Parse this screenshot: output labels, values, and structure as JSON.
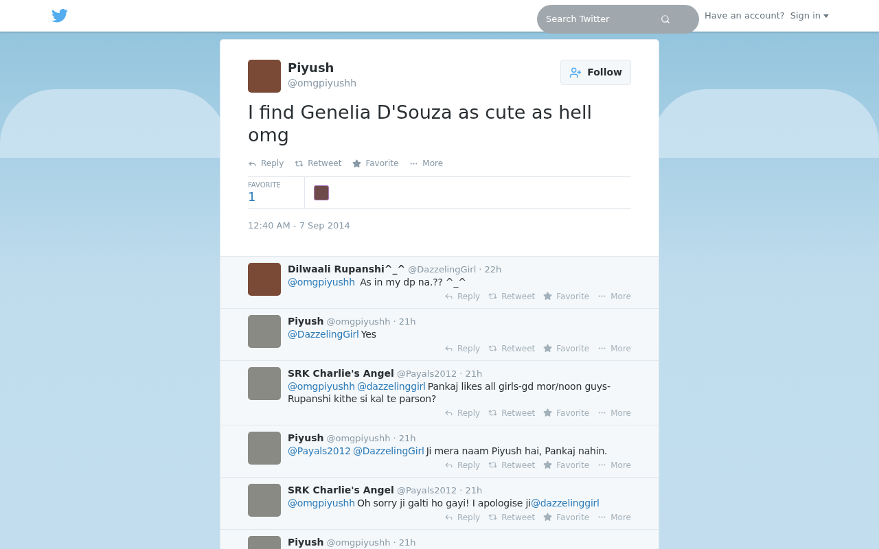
{
  "header": {
    "search": {
      "placeholder": "Search Twitter"
    },
    "account_prompt": "Have an account?",
    "sign_in": "Sign in"
  },
  "tweet": {
    "name": "Piyush",
    "handle": "@omgpiyushh",
    "follow": "Follow",
    "text": "I find Genelia D'Souza as cute as hell omg",
    "actions": [
      {
        "kind": "reply",
        "label": "Reply"
      },
      {
        "kind": "retweet",
        "label": "Retweet"
      },
      {
        "kind": "favorite",
        "label": "Favorite"
      },
      {
        "kind": "more",
        "label": "More"
      }
    ],
    "stats": {
      "label": "FAVORITE",
      "count": "1"
    },
    "timestamp": "12:40 AM - 7 Sep 2014"
  },
  "replies": [
    {
      "name": "Dilwaali Rupanshi^_^",
      "handle": "@DazzelingGirl",
      "time": "· 22h",
      "parts": [
        {
          "kind": "mention",
          "text": "@omgpiyushh"
        },
        {
          "kind": "text",
          "text": " As in my dp na.?? ^_^"
        }
      ],
      "actions": [
        "Reply",
        "Retweet",
        "Favorite",
        "More"
      ]
    },
    {
      "name": "Piyush",
      "handle": "@omgpiyushh",
      "time": "· 21h",
      "parts": [
        {
          "kind": "mention",
          "text": "@DazzelingGirl"
        },
        {
          "kind": "text",
          "text": "Yes"
        }
      ],
      "actions": [
        "Reply",
        "Retweet",
        "Favorite",
        "More"
      ]
    },
    {
      "name": "SRK Charlie's Angel",
      "handle": "@Payals2012",
      "time": "· 21h",
      "parts": [
        {
          "kind": "mention",
          "text": "@omgpiyushh"
        },
        {
          "kind": "mention",
          "text": "@dazzelinggirl"
        },
        {
          "kind": "text",
          "text": "Pankaj likes all girls-gd mor/noon guys-Rupanshi kithe si kal te parson?"
        }
      ],
      "actions": [
        "Reply",
        "Retweet",
        "Favorite",
        "More"
      ]
    },
    {
      "name": "Piyush",
      "handle": "@omgpiyushh",
      "time": "· 21h",
      "parts": [
        {
          "kind": "mention",
          "text": "@Payals2012"
        },
        {
          "kind": "mention",
          "text": "@DazzelingGirl"
        },
        {
          "kind": "text",
          "text": "Ji mera naam Piyush hai, Pankaj nahin."
        }
      ],
      "actions": [
        "Reply",
        "Retweet",
        "Favorite",
        "More"
      ]
    },
    {
      "name": "SRK Charlie's Angel",
      "handle": "@Payals2012",
      "time": "· 21h",
      "parts": [
        {
          "kind": "mention",
          "text": "@omgpiyushh"
        },
        {
          "kind": "text",
          "text": "Oh sorry ji galti ho gayi! I apologise ji"
        },
        {
          "kind": "mention",
          "text": "@dazzelinggirl"
        }
      ],
      "actions": [
        "Reply",
        "Retweet",
        "Favorite",
        "More"
      ]
    },
    {
      "name": "Piyush",
      "handle": "@omgpiyushh",
      "time": "· 21h"
    }
  ]
}
